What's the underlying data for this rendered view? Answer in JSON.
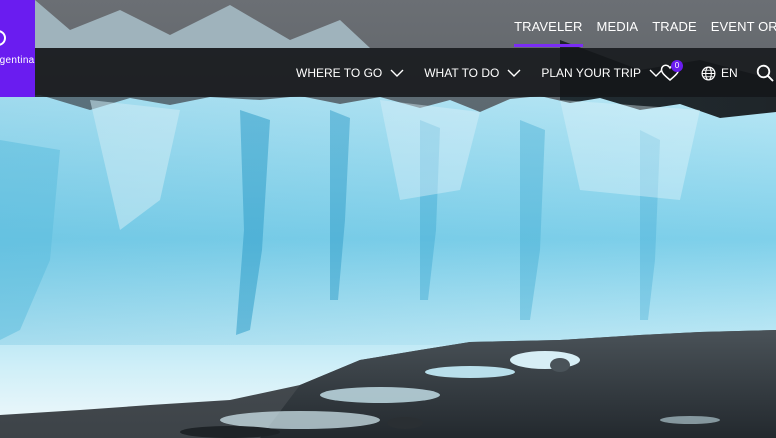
{
  "brand": {
    "wordmark": "rgentina"
  },
  "topbar": {
    "links": [
      {
        "label": "TRAVELER",
        "active": true
      },
      {
        "label": "MEDIA"
      },
      {
        "label": "TRADE"
      },
      {
        "label": "EVENT ORG"
      }
    ]
  },
  "nav": {
    "items": [
      {
        "label": "WHERE TO GO"
      },
      {
        "label": "WHAT TO DO"
      },
      {
        "label": "PLAN YOUR TRIP"
      }
    ],
    "favorites_count": "0",
    "language": "EN"
  },
  "colors": {
    "brand_purple": "#6a1cf0",
    "active_underline": "#7b2df5",
    "nav_background": "#14161a"
  },
  "icons": [
    "heart-icon",
    "globe-icon",
    "search-icon",
    "chevron-down-icon"
  ]
}
